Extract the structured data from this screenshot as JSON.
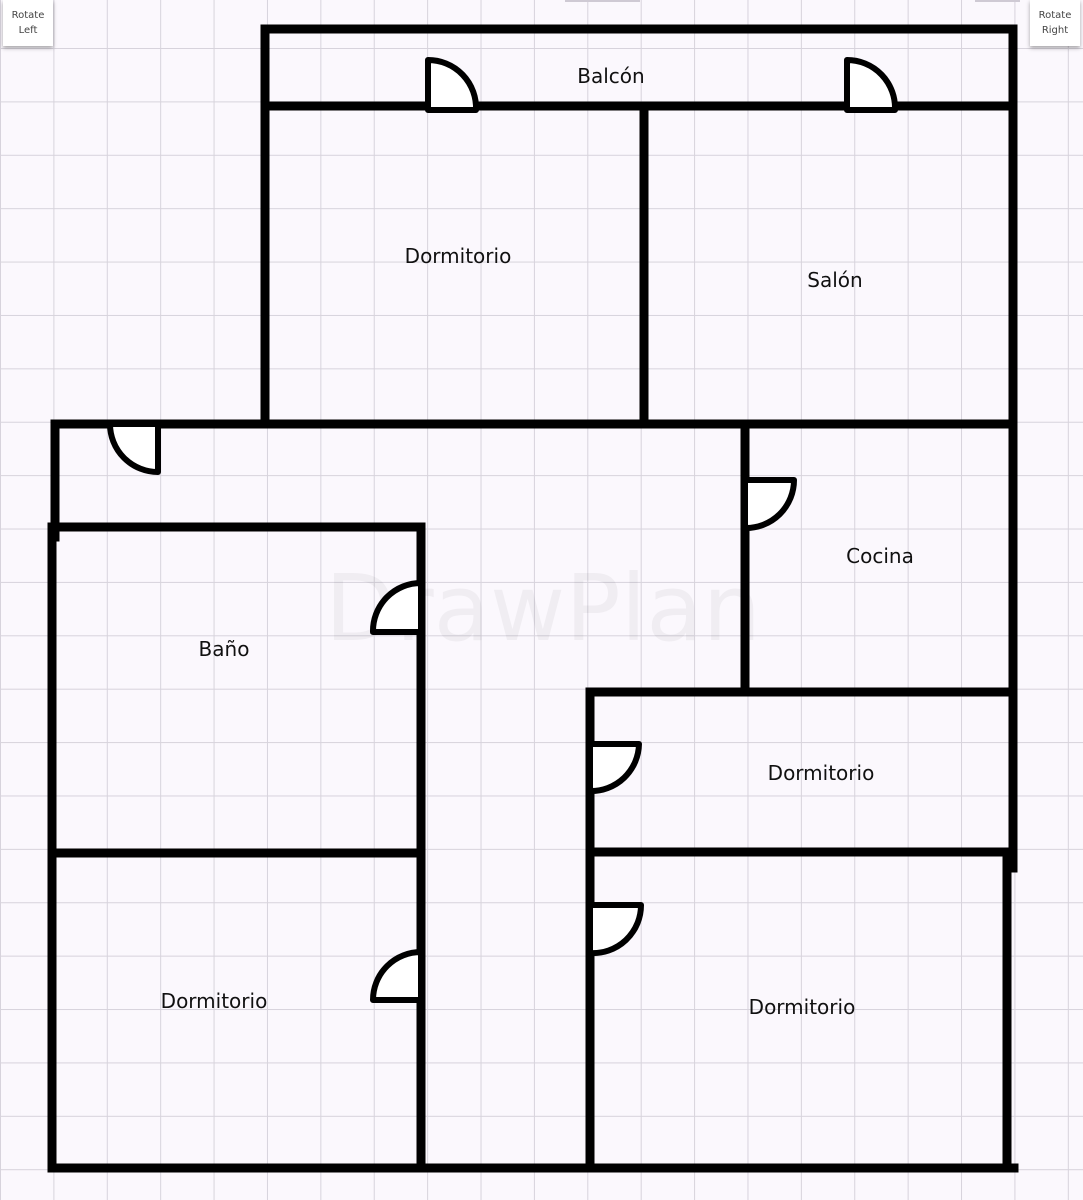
{
  "toolbar": {
    "rotate_left": [
      "Rotate",
      "Left"
    ],
    "rotate_right": [
      "Rotate",
      "Right"
    ]
  },
  "watermark": "DrawPlan",
  "rooms": {
    "balcon": "Balcón",
    "dormitorio_norte": "Dormitorio",
    "salon": "Salón",
    "cocina": "Cocina",
    "bano": "Baño",
    "dormitorio_centro": "Dormitorio",
    "dormitorio_suroeste": "Dormitorio",
    "dormitorio_sureste": "Dormitorio"
  },
  "colors": {
    "background": "#fbf8fd",
    "grid": "#d7d3dc",
    "wall": "#000000",
    "door": "#ffffff"
  },
  "icons": {
    "door": "door-swing-icon"
  }
}
